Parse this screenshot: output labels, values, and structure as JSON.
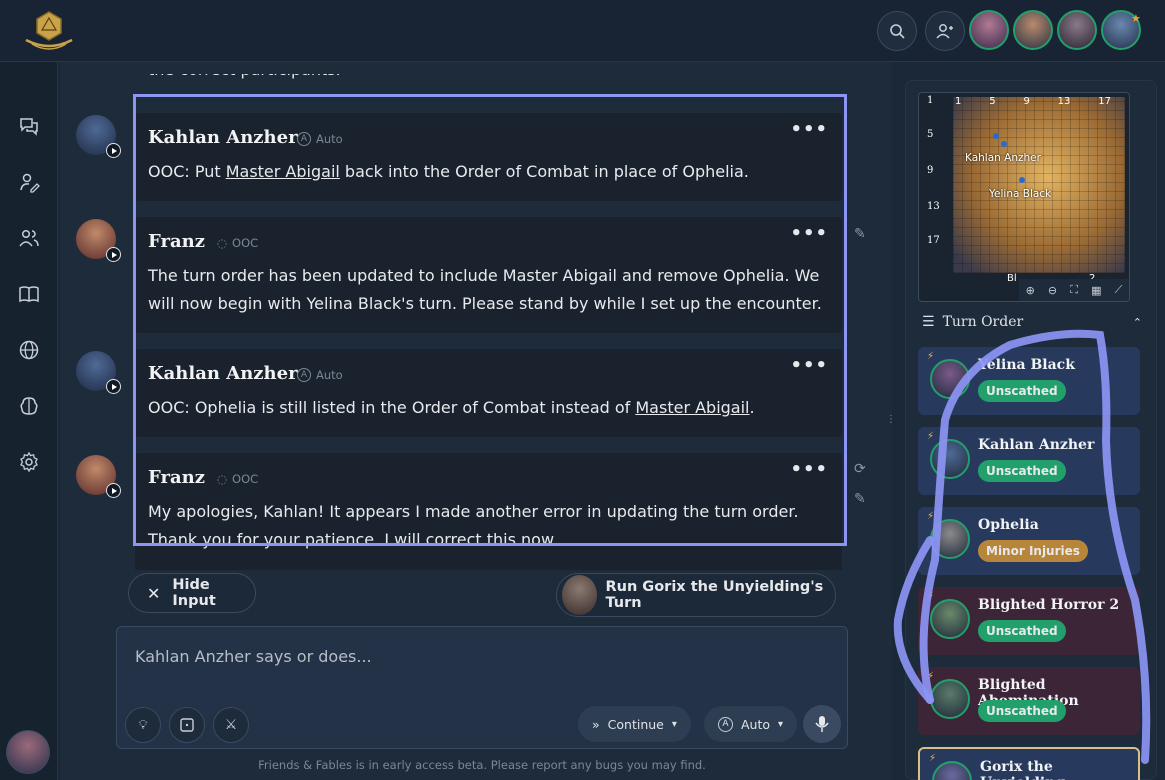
{
  "app": {
    "accent": "#8c95f4",
    "success": "#22a06b"
  },
  "topbar": {
    "search_icon": "search-icon",
    "add_user_icon": "add-user-icon",
    "avatars": [
      "party-member-1",
      "party-member-2",
      "party-member-3",
      "party-member-4"
    ]
  },
  "sidebar": {
    "items": [
      "chat-icon",
      "character-edit-icon",
      "party-icon",
      "book-icon",
      "globe-icon",
      "brain-icon",
      "gear-icon"
    ]
  },
  "feed": {
    "truncated_text": "the correct participants.",
    "messages": [
      {
        "name": "Kahlan Anzher",
        "tag": "Auto",
        "text_pre": "OOC: Put ",
        "link": "Master Abigail",
        "text_post": " back into the Order of Combat in place of Ophelia."
      },
      {
        "name": "Franz",
        "tag": "OOC",
        "text": "The turn order has been updated to include Master Abigail and remove Ophelia. We will now begin with Yelina Black's turn. Please stand by while I set up the encounter."
      },
      {
        "name": "Kahlan Anzher",
        "tag": "Auto",
        "text_pre": "OOC: Ophelia is still listed in the Order of Combat instead of ",
        "link": "Master Abigail",
        "text_post": "."
      },
      {
        "name": "Franz",
        "tag": "OOC",
        "text": "My apologies, Kahlan! It appears I made another error in updating the turn order. Thank you for your patience. I will correct this now."
      }
    ]
  },
  "actions": {
    "hide_input": "Hide Input",
    "run_turn": "Run Gorix the Unyielding's Turn"
  },
  "composer": {
    "placeholder": "Kahlan Anzher says or does...",
    "continue_label": "Continue",
    "auto_label": "Auto"
  },
  "footer": "Friends & Fables is in early access beta. Please report any bugs you may find.",
  "map": {
    "row_labels": [
      "1",
      "5",
      "9",
      "13",
      "17"
    ],
    "col_labels": [
      "1",
      "5",
      "9",
      "13",
      "17"
    ],
    "token_labels": [
      "Kahlan Anzher",
      "Yelina Black"
    ],
    "bottom_label": "Bl",
    "bottom_label_2": "2"
  },
  "turn_order": {
    "title": "Turn Order",
    "entries": [
      {
        "name": "Yelina Black",
        "status": "Unscathed",
        "status_color": "#22a06b",
        "bg": "#273a5e"
      },
      {
        "name": "Kahlan Anzher",
        "status": "Unscathed",
        "status_color": "#22a06b",
        "bg": "#273a5e"
      },
      {
        "name": "Ophelia",
        "status": "Minor Injuries",
        "status_color": "#b8863b",
        "bg": "#273a5e"
      },
      {
        "name": "Blighted Horror 2",
        "status": "Unscathed",
        "status_color": "#22a06b",
        "bg": "#3d2538"
      },
      {
        "name": "Blighted Abomination",
        "status": "Unscathed",
        "status_color": "#22a06b",
        "bg": "#3d2538"
      },
      {
        "name": "Gorix the Unyielding",
        "status": "",
        "status_color": "#22a06b",
        "bg": "#273a5e"
      }
    ]
  }
}
